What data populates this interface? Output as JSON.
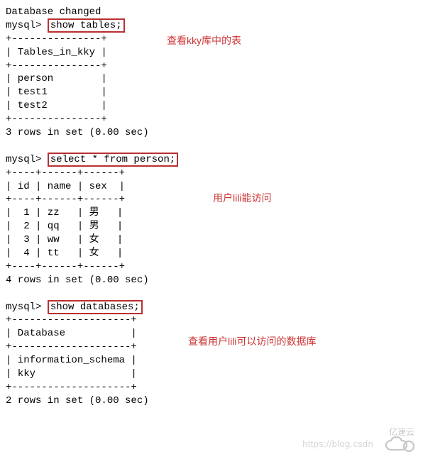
{
  "terminal": {
    "lines": [
      "Database changed",
      "mysql> ",
      "+---------------+",
      "| Tables_in_kky |",
      "+---------------+",
      "| person        |",
      "| test1         |",
      "| test2         |",
      "+---------------+",
      "3 rows in set (0.00 sec)",
      "",
      "mysql> ",
      "+----+------+------+",
      "| id | name | sex  |",
      "+----+------+------+",
      "|  1 | zz   | 男   |",
      "|  2 | qq   | 男   |",
      "|  3 | ww   | 女   |",
      "|  4 | tt   | 女   |",
      "+----+------+------+",
      "4 rows in set (0.00 sec)",
      "",
      "mysql> ",
      "+--------------------+",
      "| Database           |",
      "+--------------------+",
      "| information_schema |",
      "| kky                |",
      "+--------------------+",
      "2 rows in set (0.00 sec)"
    ],
    "highlights": {
      "show_tables": "show tables;",
      "select_person": "select * from person;",
      "show_databases": "show databases;"
    }
  },
  "annotations": {
    "a1": "查看kky库中的表",
    "a2": "用户lili能访问",
    "a3": "查看用户lili可以访问的数据库"
  },
  "watermarks": {
    "csdn": "https://blog.csdn",
    "yisuyun": "亿速云"
  }
}
